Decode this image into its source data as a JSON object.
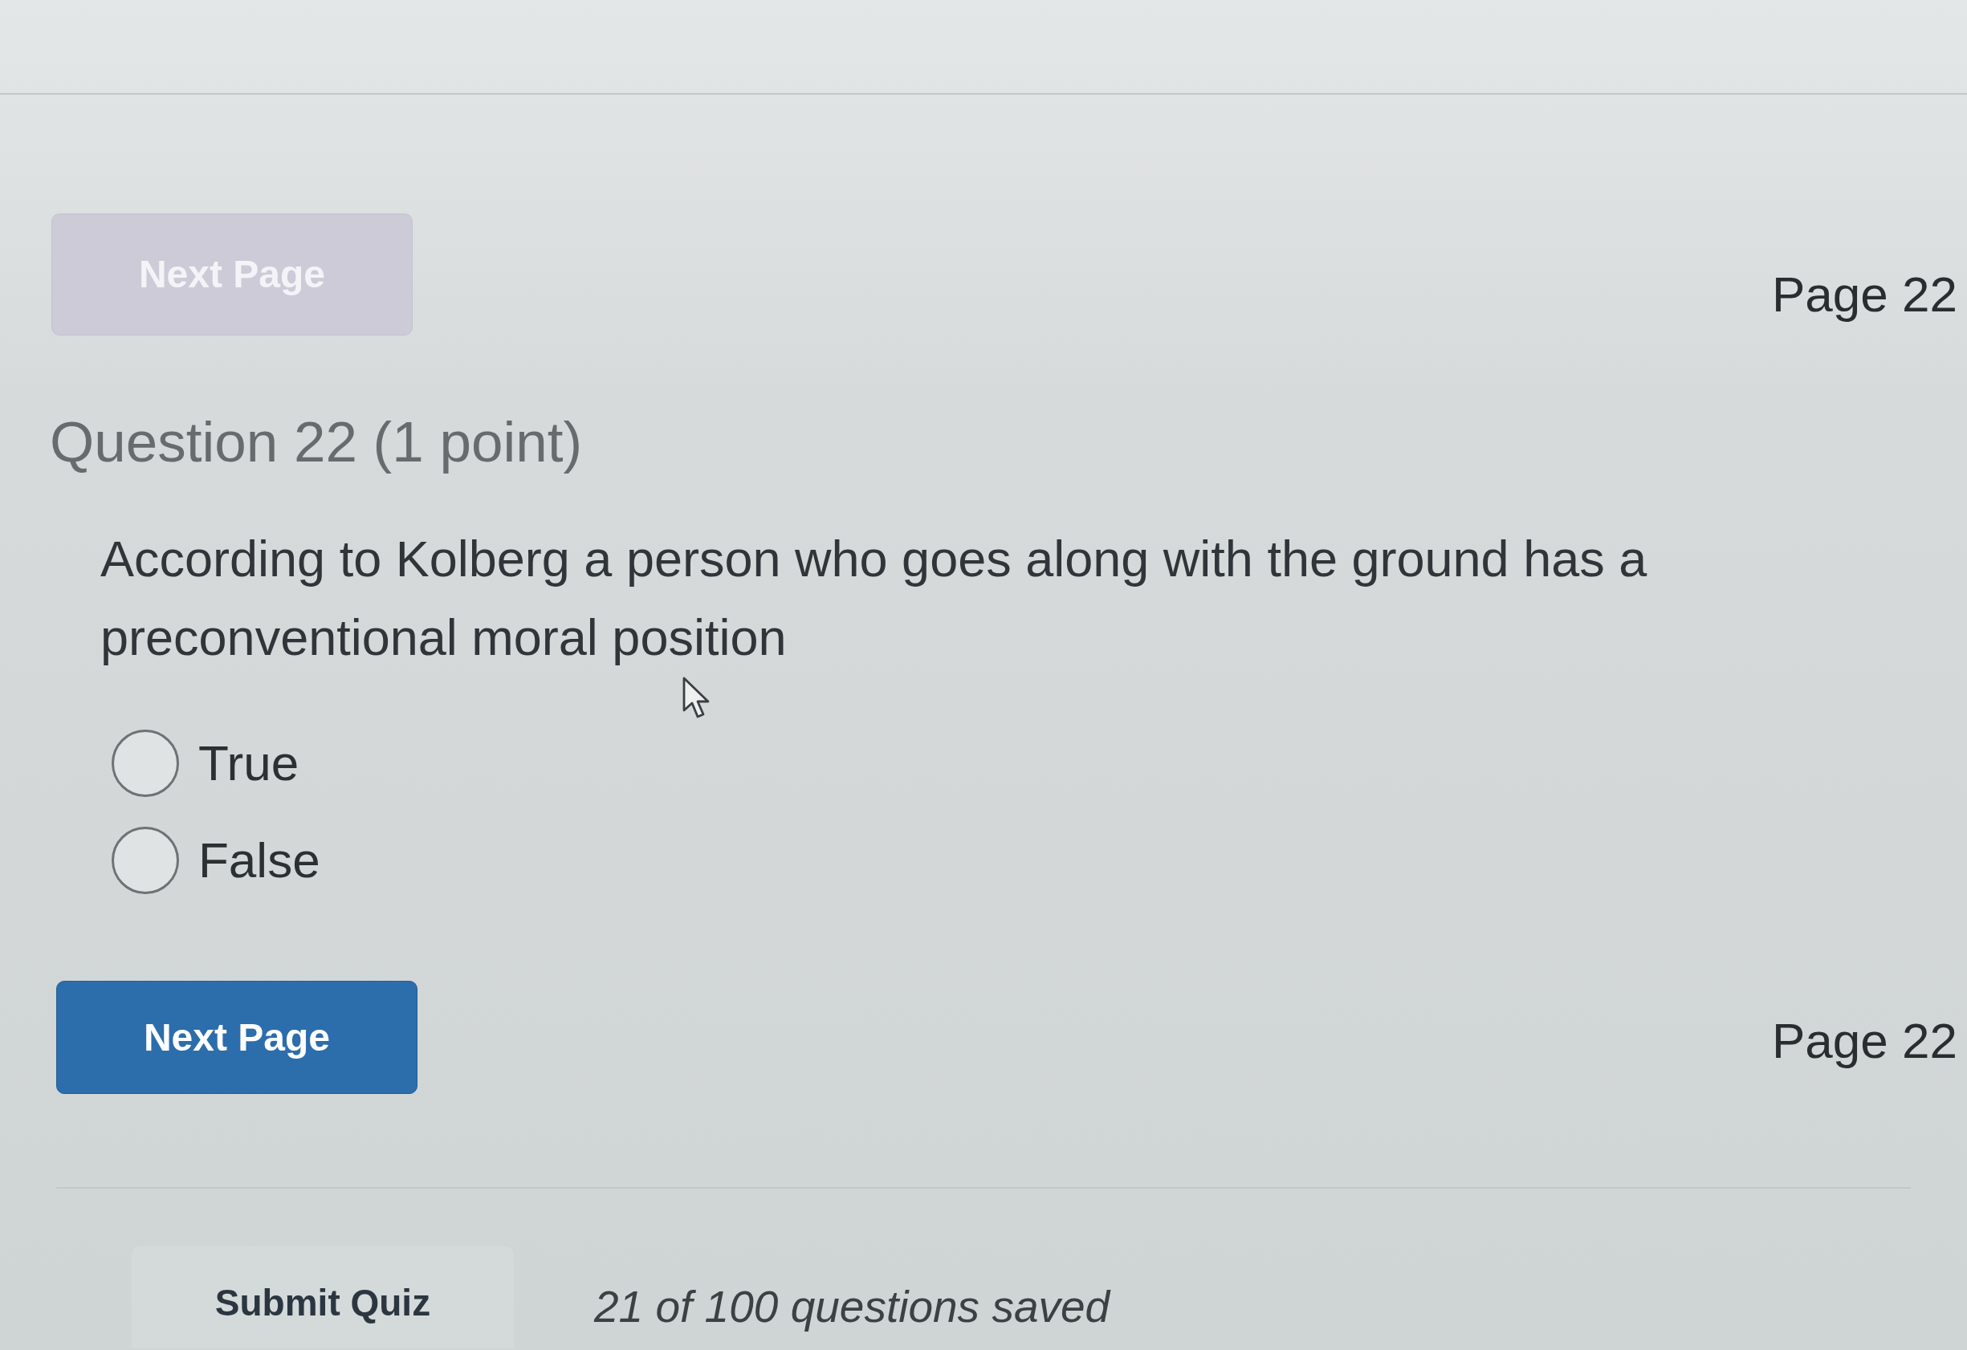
{
  "top_nav": {
    "next_button": {
      "label": "Next Page",
      "disabled": true
    },
    "page_indicator": "Page 22"
  },
  "question": {
    "title": "Question 22 (1 point)",
    "text": "According to Kolberg a person who goes along with the ground has a preconventional moral position",
    "options": [
      {
        "label": "True",
        "selected": false
      },
      {
        "label": "False",
        "selected": false
      }
    ]
  },
  "bottom_nav": {
    "next_button": {
      "label": "Next Page",
      "disabled": false
    },
    "page_indicator": "Page 22"
  },
  "footer": {
    "submit_button": "Submit Quiz",
    "status": "21 of 100 questions saved"
  }
}
